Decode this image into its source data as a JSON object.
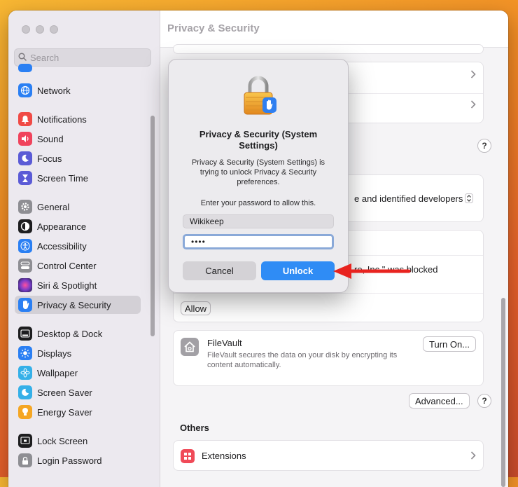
{
  "window": {
    "title": "Privacy & Security"
  },
  "search": {
    "placeholder": "Search"
  },
  "sidebar": {
    "items": [
      {
        "label": "Network",
        "icon": "globe-icon",
        "color": "#2a7ff3"
      },
      {
        "label": "Notifications",
        "icon": "bell-icon",
        "color": "#f04a45"
      },
      {
        "label": "Sound",
        "icon": "speaker-icon",
        "color": "#f0435c"
      },
      {
        "label": "Focus",
        "icon": "moon-icon",
        "color": "#5b5bd6"
      },
      {
        "label": "Screen Time",
        "icon": "hourglass-icon",
        "color": "#5b5bd6"
      },
      {
        "label": "General",
        "icon": "gear-icon",
        "color": "#8e8e93"
      },
      {
        "label": "Appearance",
        "icon": "appearance-icon",
        "color": "#1d1d1f"
      },
      {
        "label": "Accessibility",
        "icon": "accessibility-icon",
        "color": "#2a7ff3"
      },
      {
        "label": "Control Center",
        "icon": "toggles-icon",
        "color": "#8e8e93"
      },
      {
        "label": "Siri & Spotlight",
        "icon": "siri-icon",
        "color": "#7a3cc9"
      },
      {
        "label": "Privacy & Security",
        "icon": "hand-icon",
        "color": "#2a7ff3"
      },
      {
        "label": "Desktop & Dock",
        "icon": "dock-icon",
        "color": "#1d1d1f"
      },
      {
        "label": "Displays",
        "icon": "sun-icon",
        "color": "#2a7ff3"
      },
      {
        "label": "Wallpaper",
        "icon": "flower-icon",
        "color": "#35b0e8"
      },
      {
        "label": "Screen Saver",
        "icon": "screensaver-icon",
        "color": "#35b0e8"
      },
      {
        "label": "Energy Saver",
        "icon": "bulb-icon",
        "color": "#f5a623"
      },
      {
        "label": "Lock Screen",
        "icon": "lock-screen-icon",
        "color": "#1d1d1f"
      },
      {
        "label": "Login Password",
        "icon": "lock-icon",
        "color": "#8e8e93"
      }
    ]
  },
  "main": {
    "partial_dev_text": "e and identified developers",
    "blocked_text": "re, Inc.\" was blocked",
    "allow_label": "Allow",
    "filevault": {
      "title": "FileVault",
      "desc": "FileVault secures the data on your disk by encrypting its content automatically.",
      "button": "Turn On..."
    },
    "advanced_label": "Advanced...",
    "help_label": "?",
    "others_heading": "Others",
    "extensions_label": "Extensions"
  },
  "dialog": {
    "title": "Privacy & Security (System Settings)",
    "description": "Privacy & Security (System Settings) is trying to unlock Privacy & Security preferences.",
    "prompt": "Enter your password to allow this.",
    "username": "Wikikeep",
    "password": "••••",
    "cancel_label": "Cancel",
    "unlock_label": "Unlock"
  },
  "colors": {
    "accent": "#2f8cf5",
    "annotation_arrow": "#e8231f"
  }
}
